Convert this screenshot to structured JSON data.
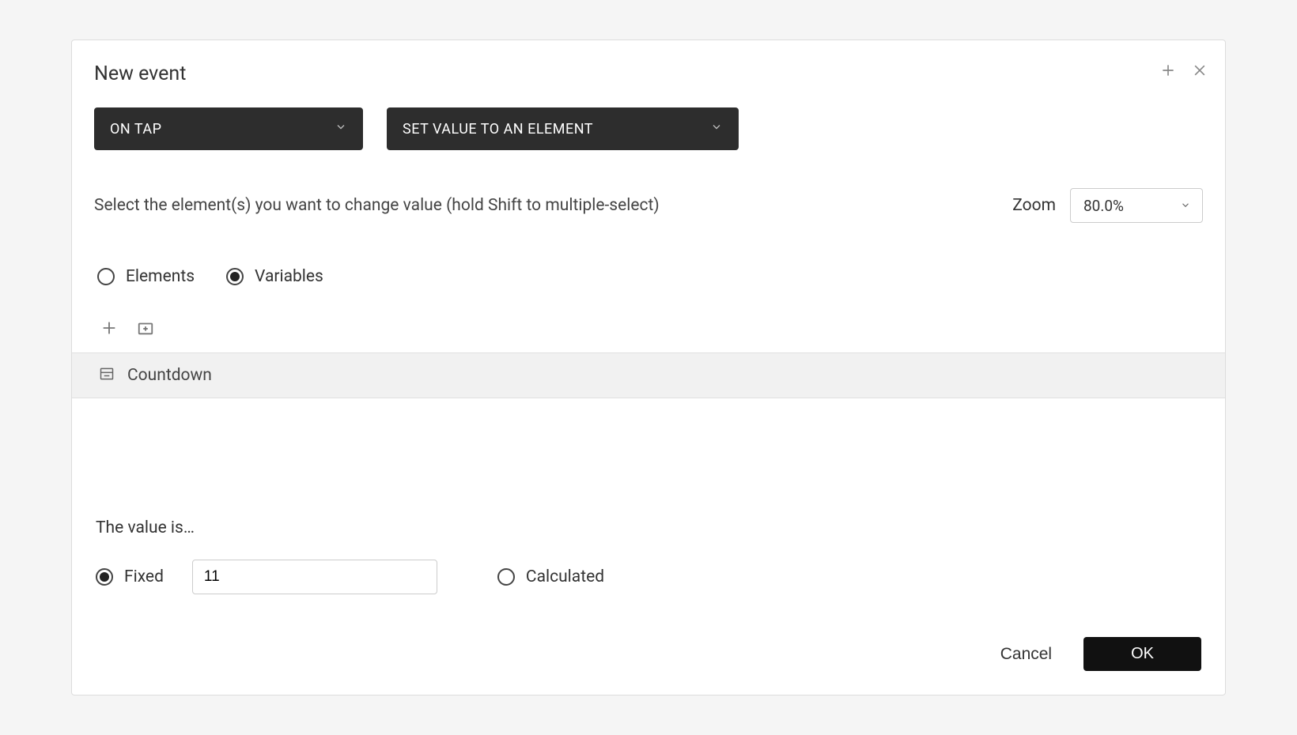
{
  "dialog": {
    "title": "New event"
  },
  "trigger": {
    "selected": "ON TAP"
  },
  "action": {
    "selected": "SET VALUE TO AN ELEMENT"
  },
  "instruction": "Select the element(s) you want to change value (hold Shift to multiple-select)",
  "zoom": {
    "label": "Zoom",
    "value": "80.0%"
  },
  "target_mode": {
    "options": {
      "elements": "Elements",
      "variables": "Variables"
    },
    "selected": "variables"
  },
  "variables": [
    {
      "name": "Countdown"
    }
  ],
  "value_section": {
    "heading": "The value is…",
    "modes": {
      "fixed": "Fixed",
      "calculated": "Calculated"
    },
    "selected": "fixed",
    "fixed_value": "11"
  },
  "footer": {
    "cancel": "Cancel",
    "ok": "OK"
  }
}
